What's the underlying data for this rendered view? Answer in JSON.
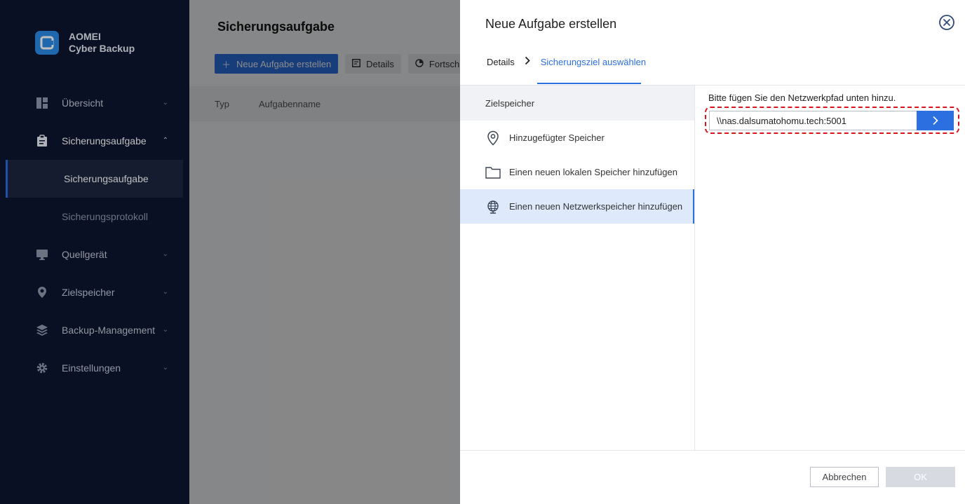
{
  "app": {
    "name_line1": "AOMEI",
    "name_line2": "Cyber Backup"
  },
  "sidebar": {
    "items": [
      {
        "label": "Übersicht",
        "icon": "dashboard-icon"
      },
      {
        "label": "Sicherungsaufgabe",
        "icon": "clipboard-icon",
        "expanded": true,
        "children": [
          {
            "label": "Sicherungsaufgabe",
            "active": true
          },
          {
            "label": "Sicherungsprotokoll"
          }
        ]
      },
      {
        "label": "Quellgerät",
        "icon": "monitor-icon"
      },
      {
        "label": "Zielspeicher",
        "icon": "location-pin-icon"
      },
      {
        "label": "Backup-Management",
        "icon": "layers-icon"
      },
      {
        "label": "Einstellungen",
        "icon": "gear-icon"
      }
    ]
  },
  "main": {
    "title": "Sicherungsaufgabe",
    "toolbar": {
      "new_task": "Neue Aufgabe erstellen",
      "details": "Details",
      "progress": "Fortschritt"
    },
    "table_headers": [
      "Typ",
      "Aufgabenname"
    ]
  },
  "dialog": {
    "title": "Neue Aufgabe erstellen",
    "steps": [
      "Details",
      "Sicherungsziel auswählen"
    ],
    "active_step": 1,
    "left": {
      "header": "Zielspeicher",
      "options": [
        {
          "label": "Hinzugefügter Speicher",
          "icon": "location-pin-icon"
        },
        {
          "label": "Einen neuen lokalen Speicher hinzufügen",
          "icon": "folder-icon"
        },
        {
          "label": "Einen neuen Netzwerkspeicher hinzufügen",
          "icon": "globe-icon",
          "selected": true
        }
      ]
    },
    "right": {
      "hint": "Bitte fügen Sie den Netzwerkpfad unten hinzu.",
      "path_value": "\\\\nas.dalsumatohomu.tech:5001"
    },
    "footer": {
      "cancel": "Abbrechen",
      "ok": "OK"
    }
  },
  "colors": {
    "accent": "#2b6fe0",
    "sidebar_bg": "#0c1630",
    "highlight_dashed": "#d8141c",
    "selected_bg": "#deeafc"
  }
}
